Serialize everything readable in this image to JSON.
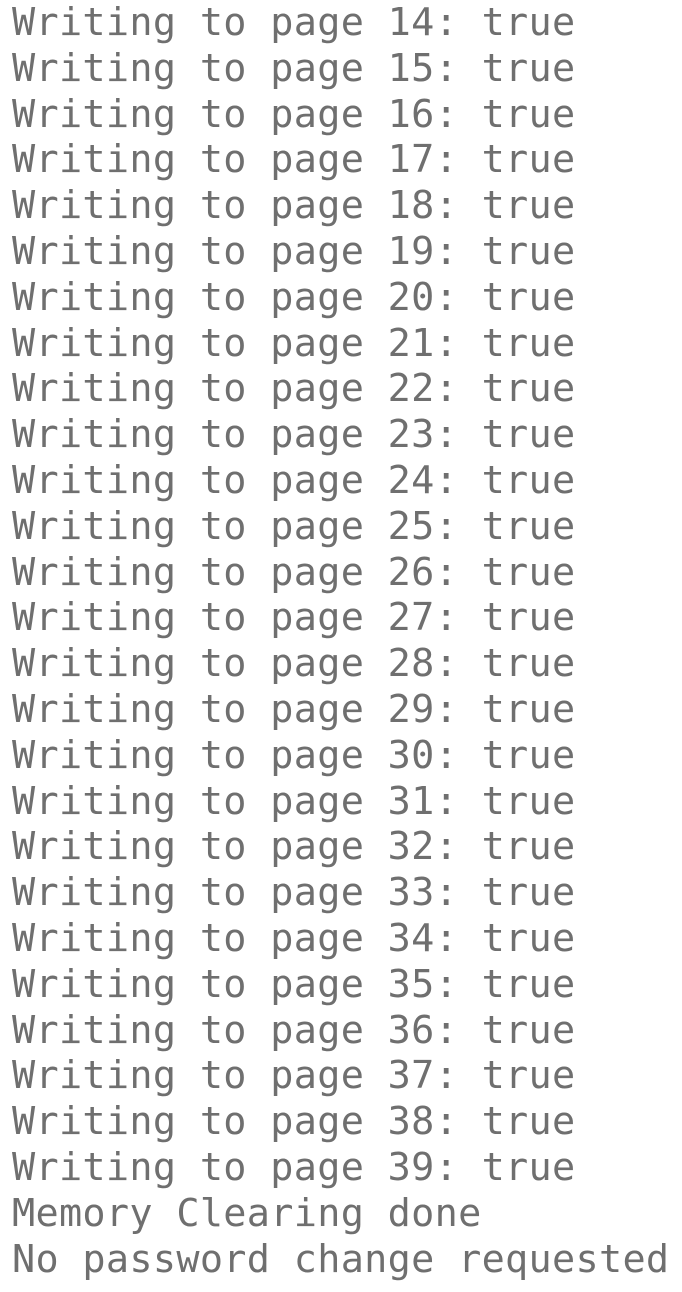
{
  "colors": {
    "background": "#ffffff",
    "text": "#6f6f6f"
  },
  "lines": [
    "Writing to page 14: true",
    "Writing to page 15: true",
    "Writing to page 16: true",
    "Writing to page 17: true",
    "Writing to page 18: true",
    "Writing to page 19: true",
    "Writing to page 20: true",
    "Writing to page 21: true",
    "Writing to page 22: true",
    "Writing to page 23: true",
    "Writing to page 24: true",
    "Writing to page 25: true",
    "Writing to page 26: true",
    "Writing to page 27: true",
    "Writing to page 28: true",
    "Writing to page 29: true",
    "Writing to page 30: true",
    "Writing to page 31: true",
    "Writing to page 32: true",
    "Writing to page 33: true",
    "Writing to page 34: true",
    "Writing to page 35: true",
    "Writing to page 36: true",
    "Writing to page 37: true",
    "Writing to page 38: true",
    "Writing to page 39: true",
    "Memory Clearing done",
    "No password change requested"
  ]
}
